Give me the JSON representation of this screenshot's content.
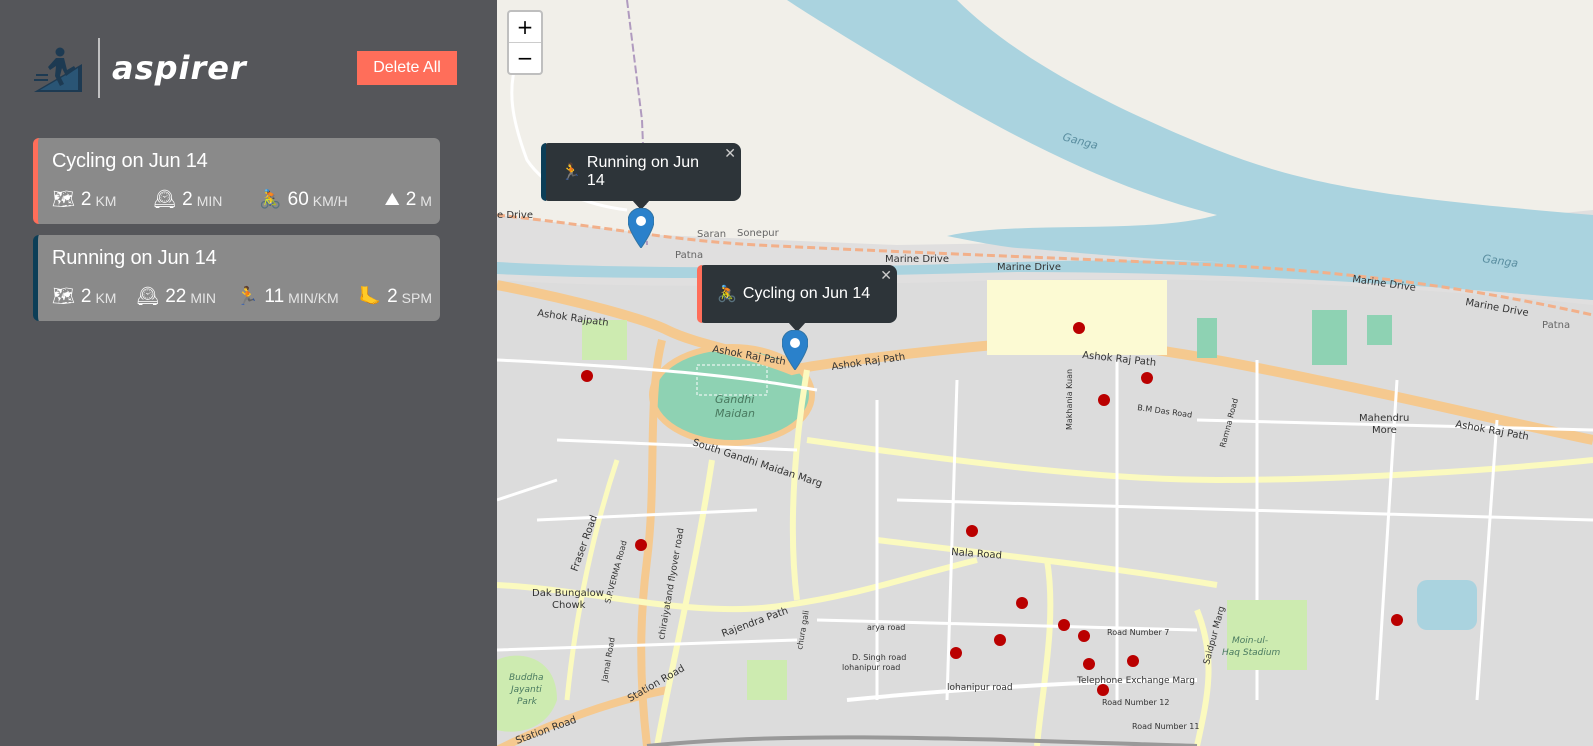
{
  "app": {
    "name": "aspirer"
  },
  "toolbar": {
    "delete_all_label": "Delete All"
  },
  "workouts": [
    {
      "type": "cycling",
      "title": "Cycling on Jun 14",
      "accent": "#ff6e5a",
      "details": [
        {
          "icon": "🗺",
          "icon_name": "map-icon",
          "value": "2",
          "unit": "KM"
        },
        {
          "icon": "🕰",
          "icon_name": "clock-icon",
          "value": "2",
          "unit": "MIN"
        },
        {
          "icon": "🚴",
          "icon_name": "cyclist-icon",
          "value": "60",
          "unit": "KM/H"
        },
        {
          "icon": "⛰",
          "icon_name": "mountain-icon",
          "value": "2",
          "unit": "M"
        }
      ]
    },
    {
      "type": "running",
      "title": "Running on Jun 14",
      "accent": "#0c3e57",
      "details": [
        {
          "icon": "🗺",
          "icon_name": "map-icon",
          "value": "2",
          "unit": "KM"
        },
        {
          "icon": "🕰",
          "icon_name": "clock-icon",
          "value": "22",
          "unit": "MIN"
        },
        {
          "icon": "🏃",
          "icon_name": "runner-icon",
          "value": "11",
          "unit": "MIN/KM"
        },
        {
          "icon": "🦶",
          "icon_name": "foot-icon",
          "value": "2",
          "unit": "SPM"
        }
      ]
    }
  ],
  "map": {
    "zoom_in": "+",
    "zoom_out": "−",
    "popups": [
      {
        "icon": "🏃",
        "label": "Running on Jun 14",
        "close": "✕",
        "accent": "#0c3e57"
      },
      {
        "icon": "🚴",
        "label": "Cycling on Jun 14",
        "close": "✕",
        "accent": "#ff6e5a"
      }
    ],
    "labels": {
      "ganga1": "Ganga",
      "ganga2": "Ganga",
      "marine1": "Marine Drive",
      "marine2": "Marine Drive",
      "marine3": "Marine Drive",
      "marine4": "Marine Drive",
      "drive": "e Drive",
      "saran": "Saran",
      "sonepur": "Sonepur",
      "patna": "Patna",
      "patna2": "Patna",
      "ashokRajpath": "Ashok Rajpath",
      "ashokRajPath1": "Ashok Raj Path",
      "ashokRajPath2": "Ashok Raj Path",
      "ashokRajPath3": "Ashok Raj Path",
      "ashokRajPath4": "Ashok Raj Path",
      "gandhi": "Gandhi",
      "maidan": "Maidan",
      "southGandhi": "South Gandhi Maidan Marg",
      "makhania": "Makhania Kuan",
      "bmDas": "B.M Das Road",
      "ramna": "Ramna Road",
      "mahendru": "Mahendru",
      "more": "More",
      "nala": "Nala Road",
      "fraser": "Fraser Road",
      "dakBungalow": "Dak Bungalow",
      "chowk": "Chowk",
      "spVerma": "S.P.VERMA Road",
      "chiraiyatand": "chiraiyatand flyover road",
      "rajendra": "Rajendra Path",
      "jamal": "Jamal Road",
      "station": "Station Road",
      "stationRoad2": "Station Road",
      "churaGali": "chura gali",
      "arya": "arya road",
      "dSingh": "D. Singh road",
      "lohanipur": "lohanipur road",
      "lohanipur2": "lohanipur road",
      "telephone": "Telephone Exchange Marg",
      "roadNo7": "Road Number 7",
      "roadNo12": "Road Number 12",
      "roadNo11": "Road Number 11",
      "saidpur": "Saidpur Marg",
      "moinul": "Moin-ul-",
      "haq": "Haq Stadium",
      "buddha": "Buddha",
      "jayanti": "Jayanti",
      "park": "Park"
    }
  }
}
